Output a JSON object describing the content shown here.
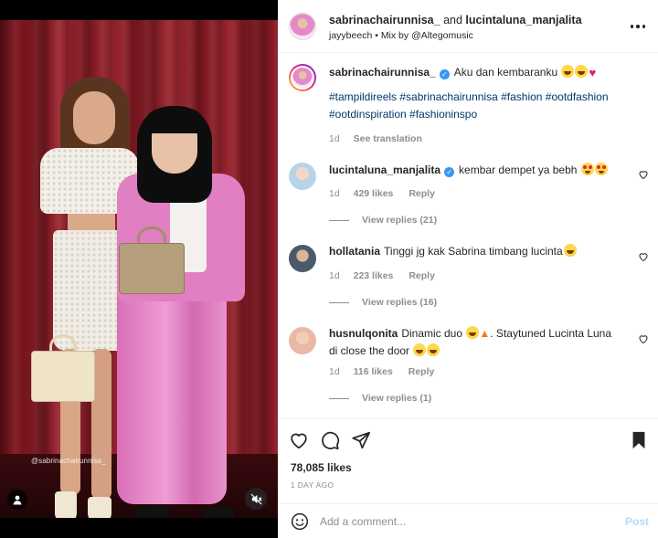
{
  "header": {
    "author": "sabrinachairunnisa_",
    "conjunction": "and",
    "coauthor": "lucintaluna_manjalita",
    "audio_user": "jayybeech",
    "audio_separator": "•",
    "audio_track": "Mix by @Altegomusic",
    "more_icon": "more-horizontal-icon"
  },
  "media": {
    "overlay_credit": "@sabrinachairunnisa_",
    "user_tag_icon": "user-tag-icon",
    "mute_icon": "speaker-muted-icon"
  },
  "caption": {
    "username": "sabrinachairunnisa_",
    "text": "Aku dan kembaranku",
    "hashtags": "#tampildireels #sabrinachairunnisa #fashion #ootdfashion #ootdinspiration #fashioninspo",
    "time": "1d",
    "translate": "See translation"
  },
  "comments": [
    {
      "username": "lucintaluna_manjalita",
      "verified": true,
      "text": "kembar dempet ya bebh",
      "time": "1d",
      "likes": "429 likes",
      "reply": "Reply",
      "view_replies": "View replies (21)"
    },
    {
      "username": "hollatania",
      "verified": false,
      "text": "Tinggi jg kak Sabrina timbang lucinta",
      "time": "1d",
      "likes": "223 likes",
      "reply": "Reply",
      "view_replies": "View replies (16)"
    },
    {
      "username": "husnulqonita",
      "verified": false,
      "text_part1": "Dinamic duo",
      "text_part2": ". Staytuned Lucinta Luna di close the door",
      "time": "1d",
      "likes": "116 likes",
      "reply": "Reply",
      "view_replies": "View replies (1)"
    }
  ],
  "actions": {
    "like_icon": "heart-icon",
    "comment_icon": "comment-icon",
    "share_icon": "paper-plane-icon",
    "save_icon": "bookmark-icon",
    "likes_count": "78,085 likes",
    "date": "1 DAY AGO"
  },
  "add_comment": {
    "placeholder": "Add a comment...",
    "post_label": "Post",
    "emoji_icon": "smiley-icon"
  },
  "colors": {
    "link": "#00376b",
    "verified": "#3897f0",
    "muted": "#8e8e8e",
    "post_disabled": "#b3dbff"
  }
}
